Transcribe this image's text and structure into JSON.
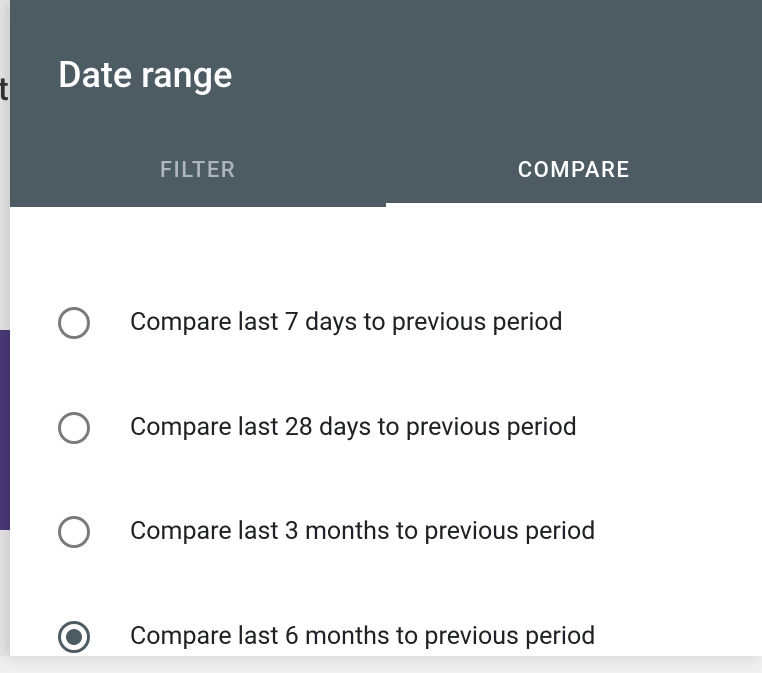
{
  "header": {
    "title": "Date range"
  },
  "tabs": [
    {
      "label": "FILTER",
      "active": false
    },
    {
      "label": "COMPARE",
      "active": true
    }
  ],
  "options": [
    {
      "label": "Compare last 7 days to previous period",
      "selected": false
    },
    {
      "label": "Compare last 28 days to previous period",
      "selected": false
    },
    {
      "label": "Compare last 3 months to previous period",
      "selected": false
    },
    {
      "label": "Compare last 6 months to previous period",
      "selected": true
    }
  ]
}
